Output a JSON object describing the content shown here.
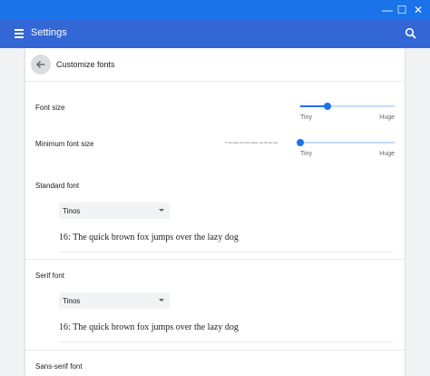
{
  "window": {
    "min_glyph": "—",
    "max_glyph": "☐",
    "close_glyph": "✕"
  },
  "appbar": {
    "title": "Settings",
    "menu_icon": "hamburger-icon",
    "search_icon": "search-icon",
    "color": "#3367d6"
  },
  "subpage": {
    "title": "Customize fonts",
    "back_icon": "arrow-back-icon"
  },
  "font_size": {
    "label": "Font size",
    "min_label": "Tiny",
    "max_label": "Huge",
    "value_fraction": 0.29
  },
  "min_font_size": {
    "label": "Minimum font size",
    "min_label": "Tiny",
    "max_label": "Huge",
    "value_fraction": 0.0,
    "preview": "0: The quick brown fox jumps over the lazy dog"
  },
  "sections": {
    "standard": {
      "title": "Standard font",
      "selected": "Tinos",
      "sample": "16: The quick brown fox jumps over the lazy dog"
    },
    "serif": {
      "title": "Serif font",
      "selected": "Tinos",
      "sample": "16: The quick brown fox jumps over the lazy dog"
    },
    "sans": {
      "title": "Sans-serif font"
    }
  },
  "colors": {
    "accent": "#1a73e8",
    "titlebar": "#1a73e8"
  }
}
